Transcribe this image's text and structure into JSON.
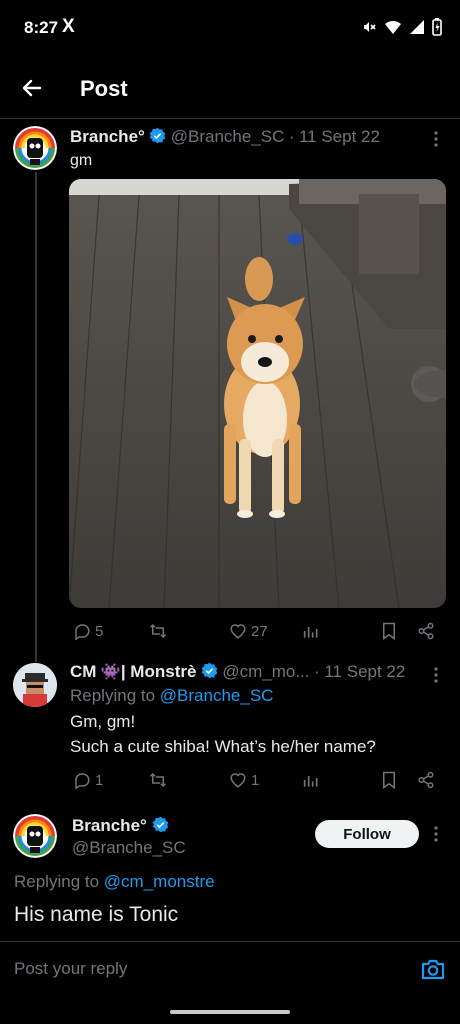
{
  "status_bar": {
    "time": "8:27",
    "x_logo": "X",
    "icons": [
      "mute-icon",
      "wifi-icon",
      "signal-icon",
      "battery-icon"
    ]
  },
  "header": {
    "title": "Post",
    "back_icon": "arrow-left-icon"
  },
  "colors": {
    "background": "#000000",
    "accent": "#1d9bf0",
    "muted": "#71767b",
    "text": "#e7e9ea",
    "divider": "#2f3336"
  },
  "tweets": [
    {
      "name": "Branche°",
      "verified": true,
      "handle": "@Branche_SC",
      "separator": "·",
      "date": "11 Sept 22",
      "text": "gm",
      "image": "shiba-inu-photo",
      "actions": {
        "replies": "5",
        "retweets": "",
        "likes": "27",
        "views": ""
      }
    },
    {
      "name": "CM",
      "name_emoji": "👾",
      "name_rest": "| Monstrè",
      "verified": true,
      "handle": "@cm_mo...",
      "date": "· 11 Sept 22",
      "replying_label": "Replying to",
      "replying_to": "@Branche_SC",
      "text_line1": "Gm, gm!",
      "text_line2": "Such a cute shiba! What’s he/her name?",
      "actions": {
        "replies": "1",
        "retweets": "",
        "likes": "1",
        "views": ""
      }
    }
  ],
  "focused_reply": {
    "name": "Branche°",
    "verified": true,
    "handle": "@Branche_SC",
    "follow_label": "Follow",
    "replying_label": "Replying to",
    "replying_to": "@cm_monstre",
    "text": "His name is Tonic"
  },
  "composer": {
    "placeholder": "Post your reply",
    "camera_icon": "camera-icon"
  }
}
